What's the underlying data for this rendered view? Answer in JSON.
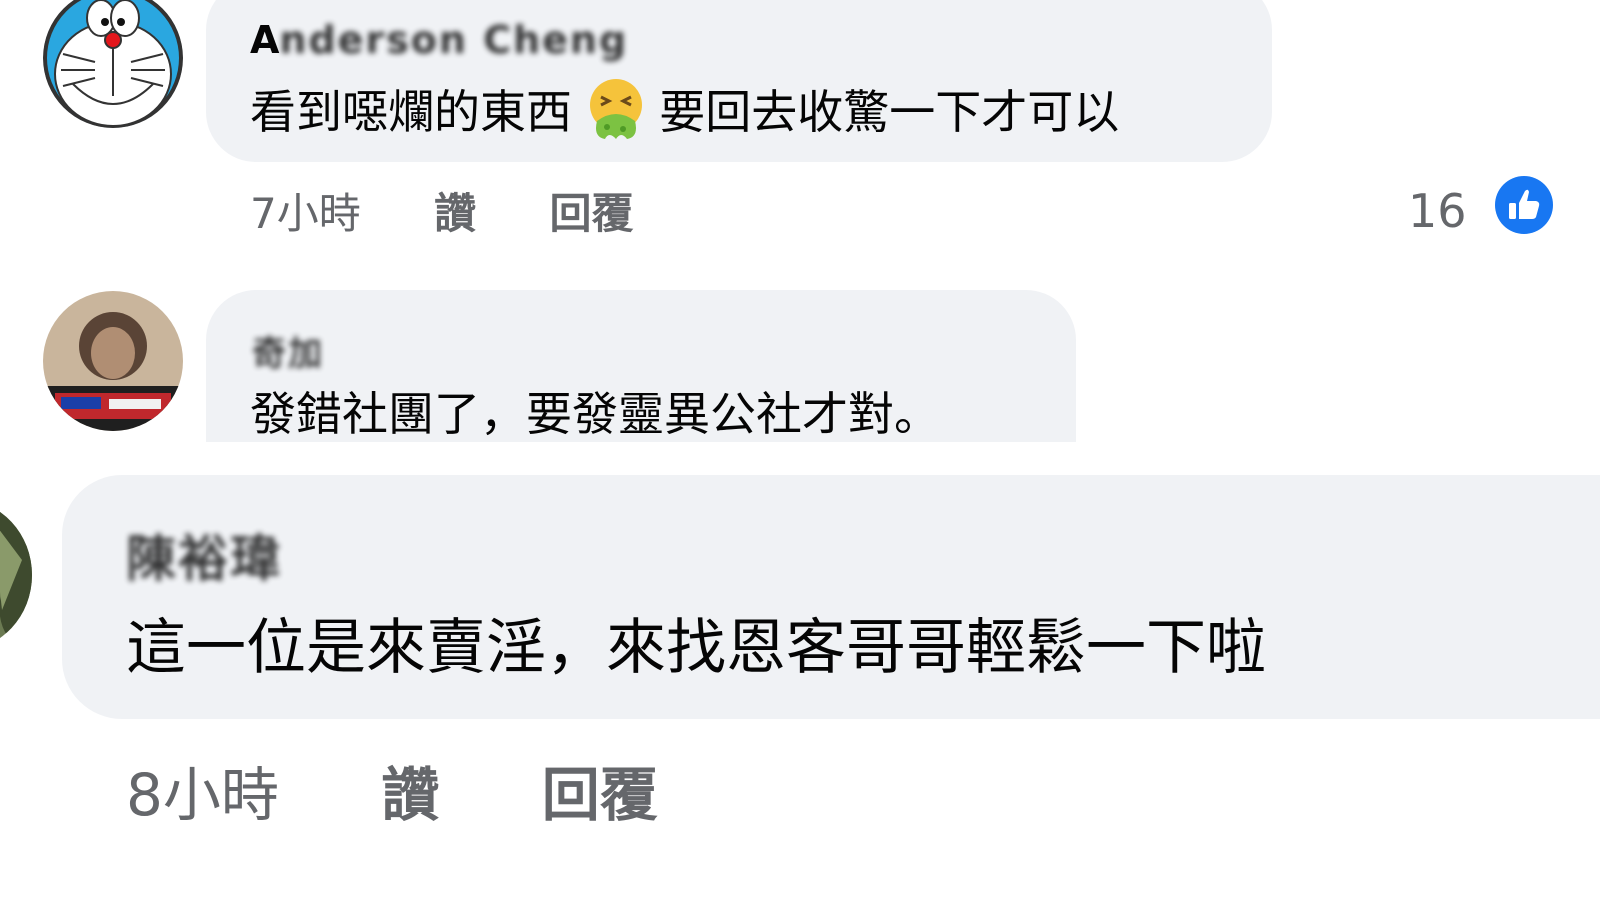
{
  "comments": [
    {
      "author_initial": "A",
      "author_rest": "nderson Cheng",
      "text_before_emoji": "看到噁爛的東西",
      "emoji": "vomiting-face",
      "text_after_emoji": "要回去收驚一下才可以",
      "time": "7小時",
      "like_label": "讚",
      "reply_label": "回覆",
      "reaction_count": "16",
      "reaction_icon": "like-thumb-icon",
      "avatar": "doraemon-avatar"
    },
    {
      "author": "奇加",
      "text": "發錯社團了，要發靈異公社才對。",
      "avatar": "photo-avatar"
    },
    {
      "author": "陳裕瑋",
      "text": "這一位是來賣淫，來找恩客哥哥輕鬆一下啦",
      "time": "8小時",
      "like_label": "讚",
      "reply_label": "回覆",
      "avatar": "photo-avatar"
    }
  ],
  "colors": {
    "bubble": "#f0f2f5",
    "meta_text": "#65676b",
    "like_blue": "#1877f2"
  }
}
